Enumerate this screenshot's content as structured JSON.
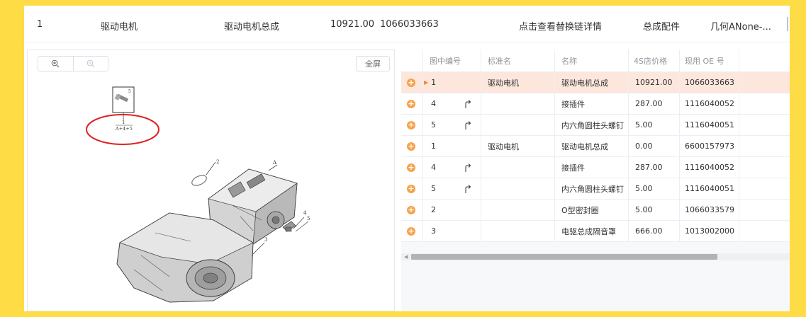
{
  "summary": {
    "index": "1",
    "standard_name": "驱动电机",
    "name": "驱动电机总成",
    "price": "10921.00",
    "oe_number": "1066033663",
    "replace_link": "点击查看替换链详情",
    "part_type": "总成配件",
    "brand": "几何ANone-..."
  },
  "toolbar": {
    "zoom_in_icon": "zoom-in-icon",
    "zoom_out_icon": "zoom-out-icon",
    "fullscreen_label": "全屏"
  },
  "diagram": {
    "callout_top": "5",
    "callout_index": "1",
    "callout_formula": "A+4+5",
    "labels": [
      "2",
      "A",
      "4",
      "5",
      "3"
    ],
    "highlight_color": "#E02020"
  },
  "table": {
    "columns": [
      "图中编号",
      "标准名",
      "名称",
      "4S店价格",
      "现用 OE 号"
    ],
    "rows": [
      {
        "num": "1",
        "std": "驱动电机",
        "name": "驱动电机总成",
        "price": "10921.00",
        "oe": "1066033663",
        "arrow": false,
        "highlight": true
      },
      {
        "num": "4",
        "std": "",
        "name": "接插件",
        "price": "287.00",
        "oe": "1116040052",
        "arrow": true,
        "highlight": false
      },
      {
        "num": "5",
        "std": "",
        "name": "内六角圆柱头螺钉",
        "price": "5.00",
        "oe": "1116040051",
        "arrow": true,
        "highlight": false
      },
      {
        "num": "1",
        "std": "驱动电机",
        "name": "驱动电机总成",
        "price": "0.00",
        "oe": "6600157973",
        "arrow": false,
        "highlight": false
      },
      {
        "num": "4",
        "std": "",
        "name": "接插件",
        "price": "287.00",
        "oe": "1116040052",
        "arrow": true,
        "highlight": false
      },
      {
        "num": "5",
        "std": "",
        "name": "内六角圆柱头螺钉",
        "price": "5.00",
        "oe": "1116040051",
        "arrow": true,
        "highlight": false
      },
      {
        "num": "2",
        "std": "",
        "name": "O型密封圈",
        "price": "5.00",
        "oe": "1066033579",
        "arrow": false,
        "highlight": false
      },
      {
        "num": "3",
        "std": "",
        "name": "电驱总成隔音罩",
        "price": "666.00",
        "oe": "1013002000",
        "arrow": false,
        "highlight": false
      }
    ]
  },
  "colors": {
    "background": "#FEDC45",
    "row_highlight": "#FDE7DC",
    "add_icon": "#F7A24B"
  }
}
